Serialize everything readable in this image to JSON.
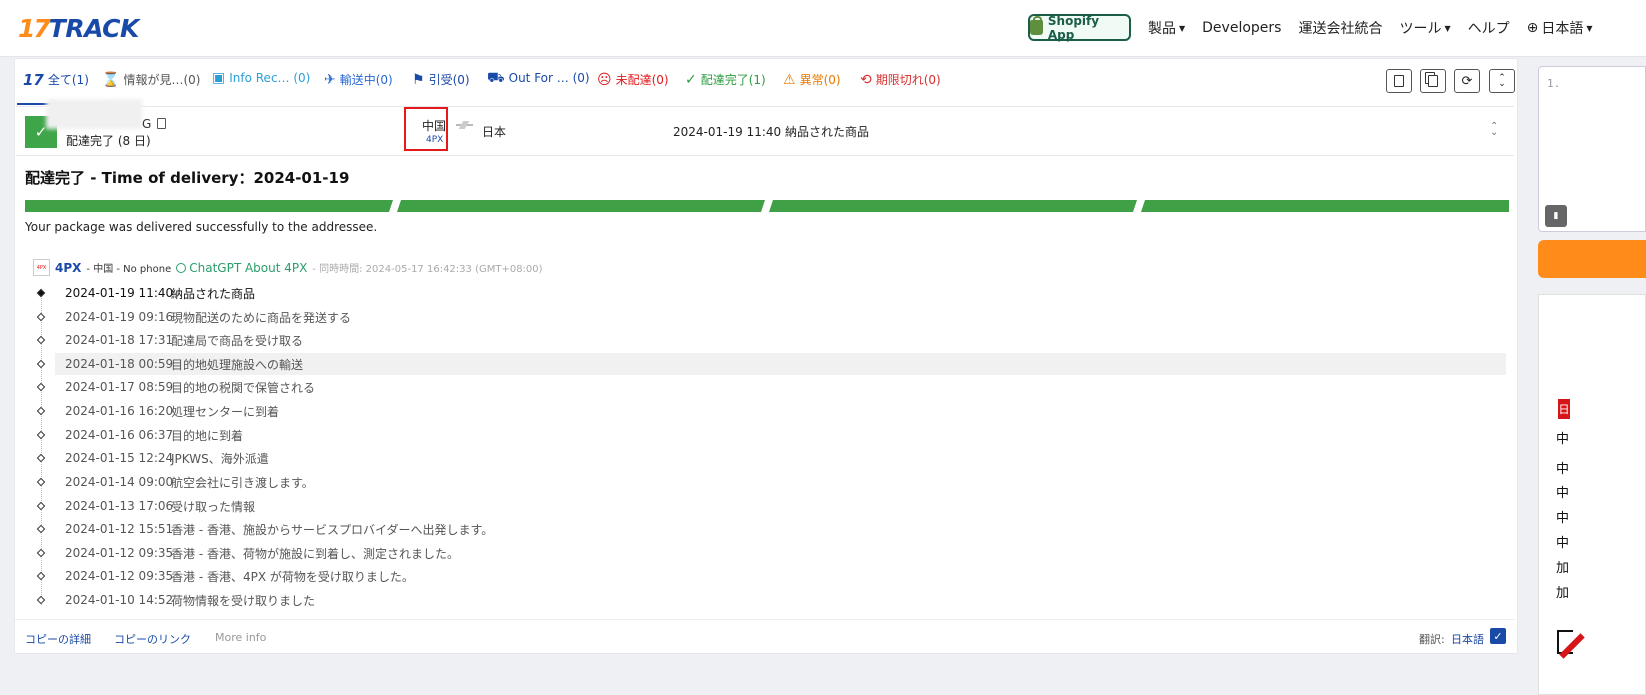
{
  "brand": {
    "logo_num": "17",
    "logo_text": "TRACK"
  },
  "topnav": {
    "shopify_label": "Shopify App",
    "items": [
      "製品",
      "Developers",
      "運送会社統合",
      "ツール",
      "ヘルプ",
      "日本語"
    ]
  },
  "tabs": [
    {
      "label": "全て(1)",
      "color": "#1a4aa8"
    },
    {
      "label": "情報が見…(0)",
      "color": "#555555"
    },
    {
      "label": "Info Rec… (0)",
      "color": "#2d9fd8"
    },
    {
      "label": "輸送中(0)",
      "color": "#2a6ad6"
    },
    {
      "label": "引受(0)",
      "color": "#1a4aa8"
    },
    {
      "label": "Out For … (0)",
      "color": "#1a4aa8"
    },
    {
      "label": "未配達(0)",
      "color": "#e3191c"
    },
    {
      "label": "配達完了(1)",
      "color": "#2e9a42"
    },
    {
      "label": "異常(0)",
      "color": "#e67a00"
    },
    {
      "label": "期限切れ(0)",
      "color": "#d62f2f"
    }
  ],
  "shipment": {
    "tracking_tail": "G",
    "status_sub": "配達完了 (8 日)",
    "origin_country": "中国",
    "origin_carrier": "4PX",
    "dest_country": "日本",
    "latest_event": "2024-01-19 11:40  納品された商品"
  },
  "detail": {
    "title": "配達完了 - Time of delivery：2024-01-19",
    "progress_segments": 4,
    "progress_complete": 4,
    "message": "Your package was delivered successfully to the addressee.",
    "carrier_logo_text": "4PX",
    "carrier_name": "4PX",
    "carrier_meta": "- 中国 - No phone",
    "gpt_link": "ChatGPT About 4PX",
    "sync_time": "- 同時時間:  2024-05-17 16:42:33 (GMT+08:00)"
  },
  "events": [
    {
      "time": "2024-01-19 11:40",
      "desc": "納品された商品"
    },
    {
      "time": "2024-01-19 09:16",
      "desc": "現物配送のために商品を発送する"
    },
    {
      "time": "2024-01-18 17:31",
      "desc": "配達局で商品を受け取る"
    },
    {
      "time": "2024-01-18 00:59",
      "desc": "目的地処理施設への輸送"
    },
    {
      "time": "2024-01-17 08:59",
      "desc": "目的地の税関で保管される"
    },
    {
      "time": "2024-01-16 16:20",
      "desc": "処理センターに到着"
    },
    {
      "time": "2024-01-16 06:37",
      "desc": "目的地に到着"
    },
    {
      "time": "2024-01-15 12:24",
      "desc": "JPKWS、海外派遣"
    },
    {
      "time": "2024-01-14 09:00",
      "desc": "航空会社に引き渡します。"
    },
    {
      "time": "2024-01-13 17:06",
      "desc": "受け取った情報"
    },
    {
      "time": "2024-01-12 15:51",
      "desc": "香港 - 香港、施設からサービスプロバイダーへ出発します。"
    },
    {
      "time": "2024-01-12 09:35",
      "desc": "香港 - 香港、荷物が施設に到着し、測定されました。"
    },
    {
      "time": "2024-01-12 09:35",
      "desc": "香港 - 香港、4PX が荷物を受け取りました。"
    },
    {
      "time": "2024-01-10 14:52",
      "desc": "荷物情報を受け取りました"
    }
  ],
  "footer": {
    "copy_details": "コピーの詳細",
    "copy_link": "コピーのリンク",
    "more_info": "More info",
    "translate_label": "翻訳:",
    "translate_lang": "日本語"
  },
  "side": {
    "line_number": "1.",
    "ad_chars": [
      "日",
      "中",
      "中",
      "中",
      "中",
      "中",
      "加",
      "加"
    ]
  }
}
